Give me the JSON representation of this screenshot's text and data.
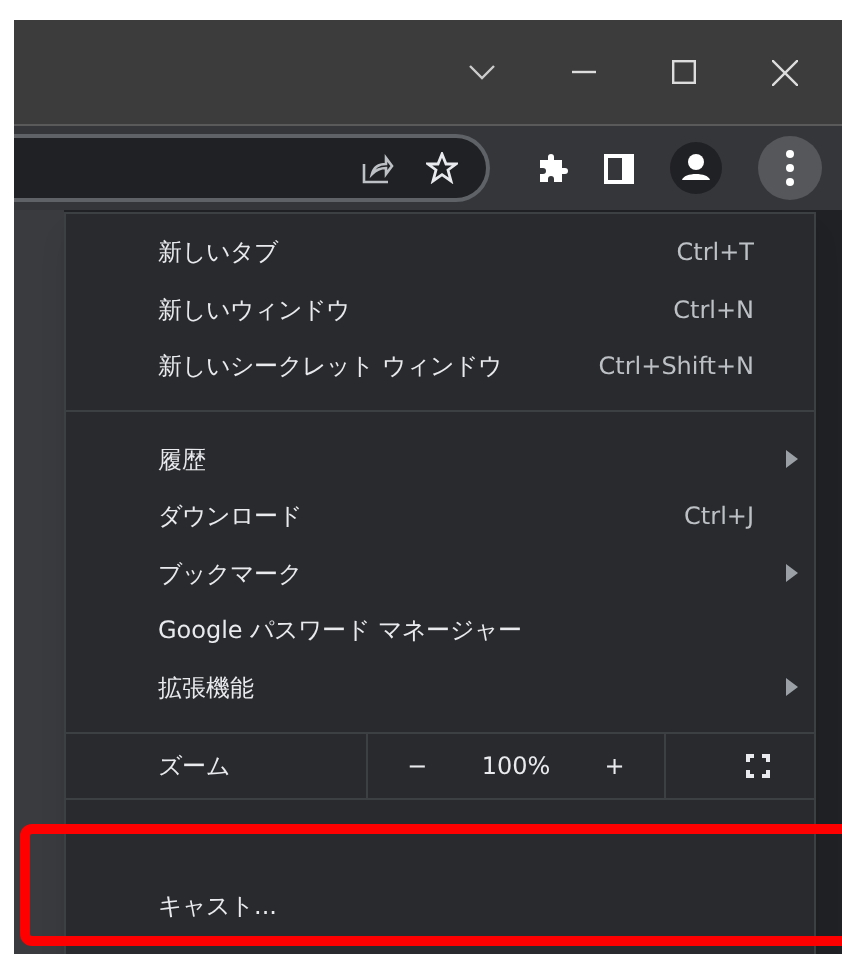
{
  "menu": {
    "sections": [
      {
        "items": [
          {
            "kind": "item",
            "label": "新しいタブ",
            "shortcut": "Ctrl+T",
            "submenu": false
          },
          {
            "kind": "item",
            "label": "新しいウィンドウ",
            "shortcut": "Ctrl+N",
            "submenu": false
          },
          {
            "kind": "item",
            "label": "新しいシークレット ウィンドウ",
            "shortcut": "Ctrl+Shift+N",
            "submenu": false
          }
        ]
      },
      {
        "items": [
          {
            "kind": "item",
            "label": "履歴",
            "submenu": true
          },
          {
            "kind": "item",
            "label": "ダウンロード",
            "shortcut": "Ctrl+J",
            "submenu": false
          },
          {
            "kind": "item",
            "label": "ブックマーク",
            "submenu": true
          },
          {
            "kind": "item",
            "label": "Google パスワード マネージャー",
            "submenu": false
          },
          {
            "kind": "item",
            "label": "拡張機能",
            "submenu": true
          }
        ]
      },
      {
        "items": [
          {
            "kind": "zoom",
            "label": "ズーム",
            "minus": "−",
            "value": "100%",
            "plus": "+"
          }
        ]
      },
      {
        "items": [
          {
            "kind": "blank"
          },
          {
            "kind": "item",
            "label": "キャスト...",
            "submenu": false
          },
          {
            "kind": "blank"
          }
        ]
      }
    ]
  }
}
